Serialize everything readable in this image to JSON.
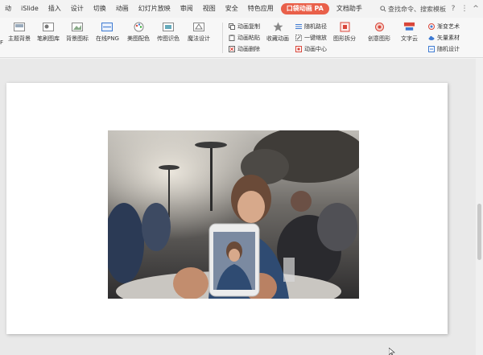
{
  "menubar": {
    "items": [
      "动",
      "iSlide",
      "插入",
      "设计",
      "切换",
      "动画",
      "幻灯片放映",
      "审阅",
      "视图",
      "安全",
      "特色应用",
      "口袋动画 PA",
      "文档助手"
    ],
    "search_label": "查找命令、搜索模板",
    "help": "?",
    "more": "⋮",
    "collapse": "^"
  },
  "ribbon": {
    "left_stub": "F",
    "big_buttons": [
      "主题背景",
      "笔刷图库",
      "背景图标",
      "在线PNG",
      "美图配色",
      "传图识色",
      "魔法设计"
    ],
    "anim_copy": "动画复制",
    "anim_paste": "动画粘贴",
    "anim_delete": "动画删除",
    "anim_collect": "收藏动画",
    "random_path": "随机路径",
    "one_key_zoom": "一键缩放",
    "anim_center": "动画中心",
    "shape_split": "图形拆分",
    "creative_shape": "创意图形",
    "word_cloud": "文字云",
    "wordart": "渐变艺术",
    "vector_material": "矢量素材",
    "random_design": "随机设计"
  },
  "colors": {
    "pa_tab": "#e9604a",
    "accent_blue": "#3e7ad2",
    "accent_red": "#d9463a"
  }
}
